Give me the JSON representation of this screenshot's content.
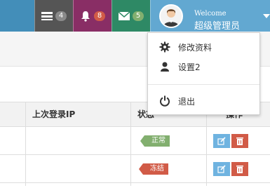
{
  "header": {
    "notifications": [
      {
        "icon": "tasks-icon",
        "count": "4",
        "color": "#555555",
        "badge_color": "#8a8a8a"
      },
      {
        "icon": "bell-icon",
        "count": "8",
        "color": "#892e65",
        "badge_color": "#d15b47"
      },
      {
        "icon": "envelope-icon",
        "count": "5",
        "color": "#2e8965",
        "badge_color": "#82af6f"
      }
    ],
    "user": {
      "welcome": "Welcome",
      "name": "超级管理员",
      "avatar_icon": "user-avatar"
    }
  },
  "dropdown": {
    "items": [
      {
        "icon": "gear-icon",
        "label": "修改资料"
      },
      {
        "icon": "user-icon",
        "label": "设置2"
      },
      {
        "icon": "power-icon",
        "label": "退出"
      }
    ]
  },
  "table": {
    "headers": [
      "上次登录IP",
      "状态",
      "操作"
    ],
    "rows": [
      {
        "status": "正常",
        "status_color": "#82af6f"
      },
      {
        "status": "冻结",
        "status_color": "#d15b47"
      }
    ]
  },
  "colors": {
    "topbar": "#438eb9",
    "user_button": "#62a8d1",
    "edit_button": "#6fb3e0",
    "delete_button": "#d15b47"
  }
}
